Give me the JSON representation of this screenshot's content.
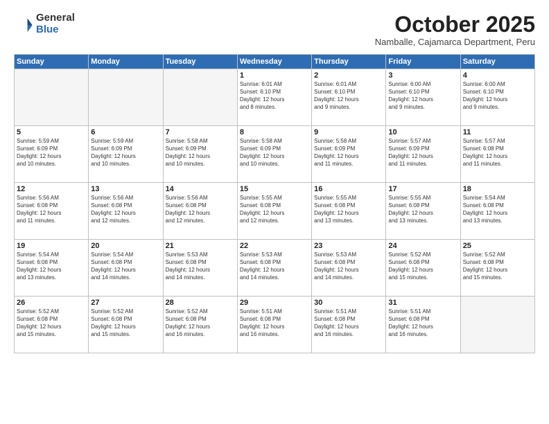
{
  "logo": {
    "general": "General",
    "blue": "Blue"
  },
  "header": {
    "month": "October 2025",
    "location": "Namballe, Cajamarca Department, Peru"
  },
  "weekdays": [
    "Sunday",
    "Monday",
    "Tuesday",
    "Wednesday",
    "Thursday",
    "Friday",
    "Saturday"
  ],
  "weeks": [
    [
      {
        "day": "",
        "info": ""
      },
      {
        "day": "",
        "info": ""
      },
      {
        "day": "",
        "info": ""
      },
      {
        "day": "1",
        "info": "Sunrise: 6:01 AM\nSunset: 6:10 PM\nDaylight: 12 hours\nand 8 minutes."
      },
      {
        "day": "2",
        "info": "Sunrise: 6:01 AM\nSunset: 6:10 PM\nDaylight: 12 hours\nand 9 minutes."
      },
      {
        "day": "3",
        "info": "Sunrise: 6:00 AM\nSunset: 6:10 PM\nDaylight: 12 hours\nand 9 minutes."
      },
      {
        "day": "4",
        "info": "Sunrise: 6:00 AM\nSunset: 6:10 PM\nDaylight: 12 hours\nand 9 minutes."
      }
    ],
    [
      {
        "day": "5",
        "info": "Sunrise: 5:59 AM\nSunset: 6:09 PM\nDaylight: 12 hours\nand 10 minutes."
      },
      {
        "day": "6",
        "info": "Sunrise: 5:59 AM\nSunset: 6:09 PM\nDaylight: 12 hours\nand 10 minutes."
      },
      {
        "day": "7",
        "info": "Sunrise: 5:58 AM\nSunset: 6:09 PM\nDaylight: 12 hours\nand 10 minutes."
      },
      {
        "day": "8",
        "info": "Sunrise: 5:58 AM\nSunset: 6:09 PM\nDaylight: 12 hours\nand 10 minutes."
      },
      {
        "day": "9",
        "info": "Sunrise: 5:58 AM\nSunset: 6:09 PM\nDaylight: 12 hours\nand 11 minutes."
      },
      {
        "day": "10",
        "info": "Sunrise: 5:57 AM\nSunset: 6:09 PM\nDaylight: 12 hours\nand 11 minutes."
      },
      {
        "day": "11",
        "info": "Sunrise: 5:57 AM\nSunset: 6:08 PM\nDaylight: 12 hours\nand 11 minutes."
      }
    ],
    [
      {
        "day": "12",
        "info": "Sunrise: 5:56 AM\nSunset: 6:08 PM\nDaylight: 12 hours\nand 11 minutes."
      },
      {
        "day": "13",
        "info": "Sunrise: 5:56 AM\nSunset: 6:08 PM\nDaylight: 12 hours\nand 12 minutes."
      },
      {
        "day": "14",
        "info": "Sunrise: 5:56 AM\nSunset: 6:08 PM\nDaylight: 12 hours\nand 12 minutes."
      },
      {
        "day": "15",
        "info": "Sunrise: 5:55 AM\nSunset: 6:08 PM\nDaylight: 12 hours\nand 12 minutes."
      },
      {
        "day": "16",
        "info": "Sunrise: 5:55 AM\nSunset: 6:08 PM\nDaylight: 12 hours\nand 13 minutes."
      },
      {
        "day": "17",
        "info": "Sunrise: 5:55 AM\nSunset: 6:08 PM\nDaylight: 12 hours\nand 13 minutes."
      },
      {
        "day": "18",
        "info": "Sunrise: 5:54 AM\nSunset: 6:08 PM\nDaylight: 12 hours\nand 13 minutes."
      }
    ],
    [
      {
        "day": "19",
        "info": "Sunrise: 5:54 AM\nSunset: 6:08 PM\nDaylight: 12 hours\nand 13 minutes."
      },
      {
        "day": "20",
        "info": "Sunrise: 5:54 AM\nSunset: 6:08 PM\nDaylight: 12 hours\nand 14 minutes."
      },
      {
        "day": "21",
        "info": "Sunrise: 5:53 AM\nSunset: 6:08 PM\nDaylight: 12 hours\nand 14 minutes."
      },
      {
        "day": "22",
        "info": "Sunrise: 5:53 AM\nSunset: 6:08 PM\nDaylight: 12 hours\nand 14 minutes."
      },
      {
        "day": "23",
        "info": "Sunrise: 5:53 AM\nSunset: 6:08 PM\nDaylight: 12 hours\nand 14 minutes."
      },
      {
        "day": "24",
        "info": "Sunrise: 5:52 AM\nSunset: 6:08 PM\nDaylight: 12 hours\nand 15 minutes."
      },
      {
        "day": "25",
        "info": "Sunrise: 5:52 AM\nSunset: 6:08 PM\nDaylight: 12 hours\nand 15 minutes."
      }
    ],
    [
      {
        "day": "26",
        "info": "Sunrise: 5:52 AM\nSunset: 6:08 PM\nDaylight: 12 hours\nand 15 minutes."
      },
      {
        "day": "27",
        "info": "Sunrise: 5:52 AM\nSunset: 6:08 PM\nDaylight: 12 hours\nand 15 minutes."
      },
      {
        "day": "28",
        "info": "Sunrise: 5:52 AM\nSunset: 6:08 PM\nDaylight: 12 hours\nand 16 minutes."
      },
      {
        "day": "29",
        "info": "Sunrise: 5:51 AM\nSunset: 6:08 PM\nDaylight: 12 hours\nand 16 minutes."
      },
      {
        "day": "30",
        "info": "Sunrise: 5:51 AM\nSunset: 6:08 PM\nDaylight: 12 hours\nand 16 minutes."
      },
      {
        "day": "31",
        "info": "Sunrise: 5:51 AM\nSunset: 6:08 PM\nDaylight: 12 hours\nand 16 minutes."
      },
      {
        "day": "",
        "info": ""
      }
    ]
  ]
}
